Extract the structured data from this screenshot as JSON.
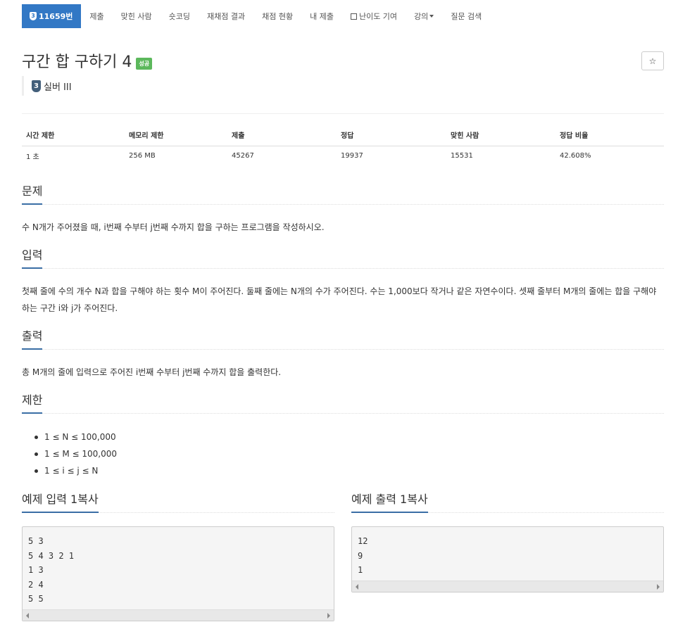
{
  "nav": {
    "tier_badge": "3",
    "problem_id": "11659번",
    "items": [
      "제출",
      "맞힌 사람",
      "숏코딩",
      "재채점 결과",
      "채점 현황",
      "내 제출",
      "난이도 기여",
      "강의",
      "질문 검색"
    ]
  },
  "problem": {
    "title": "구간 합 구하기 4",
    "status_badge": "성공",
    "tier_number": "3",
    "tier_name": "실버 III",
    "star": "☆"
  },
  "info_table": {
    "headers": [
      "시간 제한",
      "메모리 제한",
      "제출",
      "정답",
      "맞힌 사람",
      "정답 비율"
    ],
    "values": [
      "1 초",
      "256 MB",
      "45267",
      "19937",
      "15531",
      "42.608%"
    ]
  },
  "sections": {
    "problem": {
      "title": "문제",
      "text": "수 N개가 주어졌을 때, i번째 수부터 j번째 수까지 합을 구하는 프로그램을 작성하시오."
    },
    "input": {
      "title": "입력",
      "text": "첫째 줄에 수의 개수 N과 합을 구해야 하는 횟수 M이 주어진다. 둘째 줄에는 N개의 수가 주어진다. 수는 1,000보다 작거나 같은 자연수이다. 셋째 줄부터 M개의 줄에는 합을 구해야 하는 구간 i와 j가 주어진다."
    },
    "output": {
      "title": "출력",
      "text": "총 M개의 줄에 입력으로 주어진 i번째 수부터 j번째 수까지 합을 출력한다."
    },
    "limit": {
      "title": "제한",
      "items": [
        "1 ≤ N ≤ 100,000",
        "1 ≤ M ≤ 100,000",
        "1 ≤ i ≤ j ≤ N"
      ]
    }
  },
  "samples": {
    "input": {
      "title": "예제 입력 1",
      "copy": "복사",
      "lines": [
        "5 3",
        "5 4 3 2 1",
        "1 3",
        "2 4",
        "5 5"
      ]
    },
    "output": {
      "title": "예제 출력 1",
      "copy": "복사",
      "lines": [
        "12",
        "9",
        "1"
      ]
    }
  },
  "colors": {
    "primary": "#3278c5",
    "success": "#5cb85c",
    "tier_silver": "#435f7a"
  }
}
